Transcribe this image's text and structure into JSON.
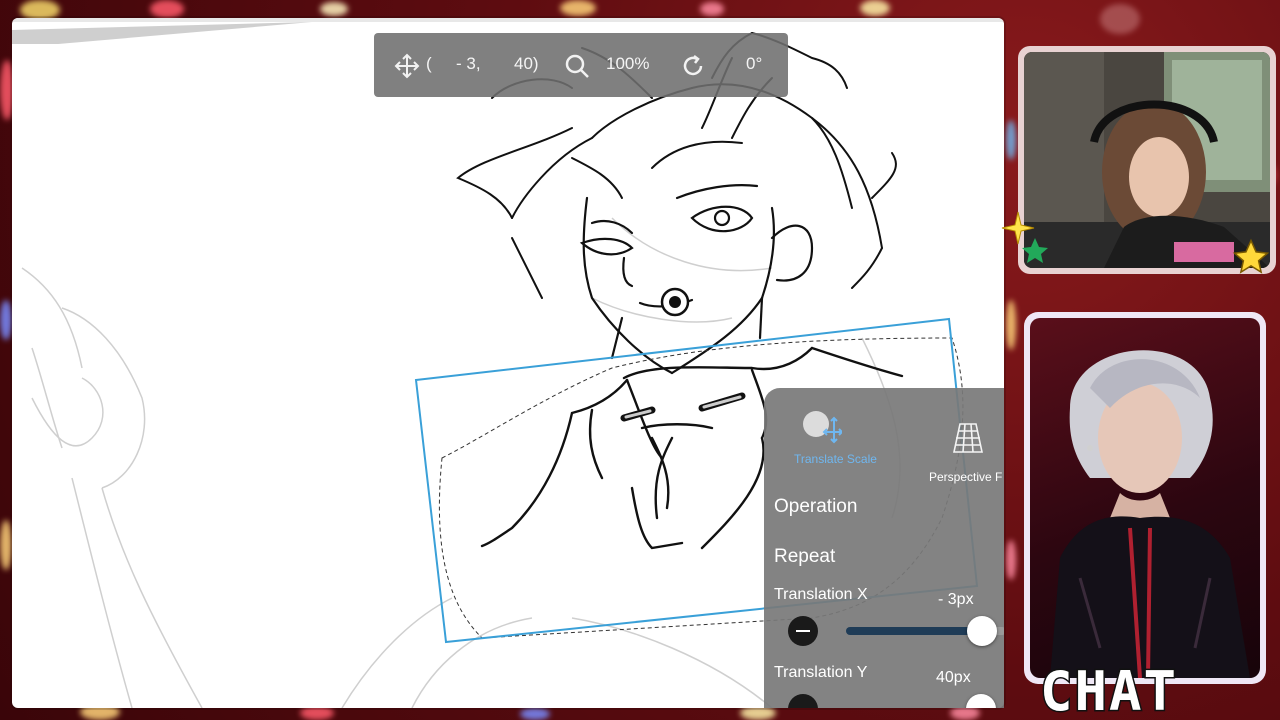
{
  "toolbar": {
    "move_icon": "move-arrows-icon",
    "coord_open": "(",
    "x_value": "- 3,",
    "y_value": "40)",
    "zoom_icon": "magnifier-icon",
    "zoom_value": "100%",
    "rotate_icon": "rotate-icon",
    "rotation_value": "0°"
  },
  "transform_panel": {
    "modes": [
      {
        "label": "Translate Scale",
        "icon": "translate-scale-icon",
        "active": true
      },
      {
        "label": "Perspective F",
        "icon": "perspective-grid-icon",
        "active": false
      }
    ],
    "operation_label": "Operation",
    "repeat_label": "Repeat",
    "translation_x": {
      "label": "Translation X",
      "value": "- 3px",
      "fraction": 0.85
    },
    "translation_y": {
      "label": "Translation Y",
      "value": "40px"
    }
  },
  "overlay": {
    "chat_label": "CHAT"
  },
  "colors": {
    "selection_box": "#3aa0d8",
    "accent_blue": "#6fb7f0",
    "panel_bg": "#787878",
    "background": "#5e0c10"
  }
}
